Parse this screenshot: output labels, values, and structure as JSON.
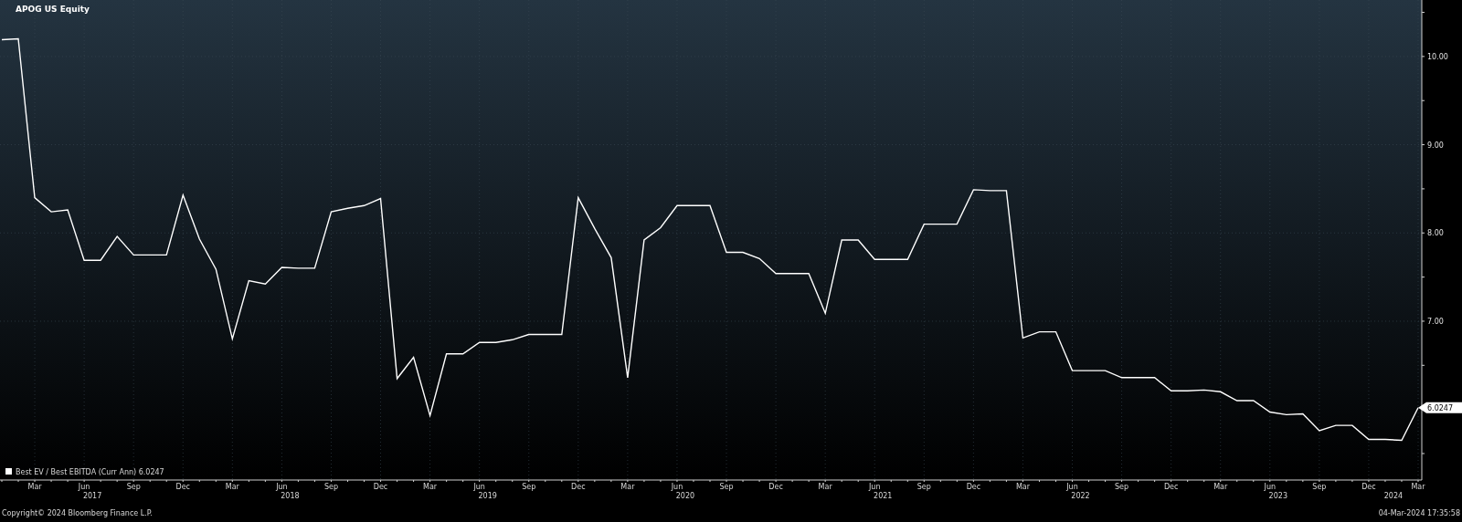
{
  "title": "APOG US Equity",
  "chart": {
    "chart_data": {
      "type": "line",
      "x": [
        "2017-01",
        "2017-02",
        "2017-03",
        "2017-04",
        "2017-05",
        "2017-06",
        "2017-07",
        "2017-08",
        "2017-09",
        "2017-10",
        "2017-11",
        "2017-12",
        "2018-01",
        "2018-02",
        "2018-03",
        "2018-04",
        "2018-05",
        "2018-06",
        "2018-07",
        "2018-08",
        "2018-09",
        "2018-10",
        "2018-11",
        "2018-12",
        "2019-01",
        "2019-02",
        "2019-03",
        "2019-04",
        "2019-05",
        "2019-06",
        "2019-07",
        "2019-08",
        "2019-09",
        "2019-10",
        "2019-11",
        "2019-12",
        "2020-01",
        "2020-02",
        "2020-03",
        "2020-04",
        "2020-05",
        "2020-06",
        "2020-07",
        "2020-08",
        "2020-09",
        "2020-10",
        "2020-11",
        "2020-12",
        "2021-01",
        "2021-02",
        "2021-03",
        "2021-04",
        "2021-05",
        "2021-06",
        "2021-07",
        "2021-08",
        "2021-09",
        "2021-10",
        "2021-11",
        "2021-12",
        "2022-01",
        "2022-02",
        "2022-03",
        "2022-04",
        "2022-05",
        "2022-06",
        "2022-07",
        "2022-08",
        "2022-09",
        "2022-10",
        "2022-11",
        "2022-12",
        "2023-01",
        "2023-02",
        "2023-03",
        "2023-04",
        "2023-05",
        "2023-06",
        "2023-07",
        "2023-08",
        "2023-09",
        "2023-10",
        "2023-11",
        "2023-12",
        "2024-01",
        "2024-02",
        "2024-03"
      ],
      "series": [
        {
          "name": "Best EV / Best EBITDA (Curr Ann)",
          "color": "#ffffff",
          "values": [
            10.19,
            10.2,
            8.4,
            8.24,
            8.26,
            7.69,
            7.69,
            7.96,
            7.75,
            7.75,
            7.75,
            8.43,
            7.93,
            7.59,
            6.8,
            7.46,
            7.42,
            7.61,
            7.6,
            7.6,
            8.24,
            8.28,
            8.31,
            8.39,
            6.35,
            6.59,
            5.93,
            6.63,
            6.63,
            6.76,
            6.76,
            6.79,
            6.85,
            6.85,
            6.85,
            8.4,
            8.05,
            7.72,
            6.36,
            7.92,
            8.06,
            8.31,
            8.31,
            8.31,
            7.78,
            7.78,
            7.71,
            7.54,
            7.54,
            7.54,
            7.09,
            7.92,
            7.92,
            7.7,
            7.7,
            7.7,
            8.1,
            8.1,
            8.1,
            8.49,
            8.48,
            8.48,
            6.81,
            6.88,
            6.88,
            6.44,
            6.44,
            6.44,
            6.36,
            6.36,
            6.36,
            6.21,
            6.21,
            6.22,
            6.2,
            6.1,
            6.1,
            5.97,
            5.94,
            5.95,
            5.76,
            5.82,
            5.82,
            5.66,
            5.66,
            5.65,
            6.02
          ]
        }
      ],
      "xlim": [
        "2017-01",
        "2024-03"
      ],
      "grid": true,
      "ylim": [
        5.2,
        10.64
      ],
      "yticks": [
        {
          "value": 7,
          "label": "7.00"
        },
        {
          "value": 8,
          "label": "8.00"
        },
        {
          "value": 9,
          "label": "9.00"
        },
        {
          "value": 10,
          "label": "10.00"
        }
      ],
      "xticks": [
        {
          "value": "2017-03",
          "label": "Mar"
        },
        {
          "value": "2017-06",
          "label": "Jun"
        },
        {
          "value": "2017-09",
          "label": "Sep"
        },
        {
          "value": "2017-12",
          "label": "Dec"
        },
        {
          "value": "2018-03",
          "label": "Mar"
        },
        {
          "value": "2018-06",
          "label": "Jun"
        },
        {
          "value": "2018-09",
          "label": "Sep"
        },
        {
          "value": "2018-12",
          "label": "Dec"
        },
        {
          "value": "2019-03",
          "label": "Mar"
        },
        {
          "value": "2019-06",
          "label": "Jun"
        },
        {
          "value": "2019-09",
          "label": "Sep"
        },
        {
          "value": "2019-12",
          "label": "Dec"
        },
        {
          "value": "2020-03",
          "label": "Mar"
        },
        {
          "value": "2020-06",
          "label": "Jun"
        },
        {
          "value": "2020-09",
          "label": "Sep"
        },
        {
          "value": "2020-12",
          "label": "Dec"
        },
        {
          "value": "2021-03",
          "label": "Mar"
        },
        {
          "value": "2021-06",
          "label": "Jun"
        },
        {
          "value": "2021-09",
          "label": "Sep"
        },
        {
          "value": "2021-12",
          "label": "Dec"
        },
        {
          "value": "2022-03",
          "label": "Mar"
        },
        {
          "value": "2022-06",
          "label": "Jun"
        },
        {
          "value": "2022-09",
          "label": "Sep"
        },
        {
          "value": "2022-12",
          "label": "Dec"
        },
        {
          "value": "2023-03",
          "label": "Mar"
        },
        {
          "value": "2023-06",
          "label": "Jun"
        },
        {
          "value": "2023-09",
          "label": "Sep"
        },
        {
          "value": "2023-12",
          "label": "Dec"
        },
        {
          "value": "2024-03",
          "label": "Mar"
        }
      ],
      "annotations": [
        {
          "text": "6.0247",
          "x": "2024-03",
          "y": 6.02
        }
      ]
    },
    "year_labels": [
      "2017",
      "2018",
      "2019",
      "2020",
      "2021",
      "2022",
      "2023",
      "2024"
    ],
    "legend": {
      "value": "6.0247"
    }
  },
  "footer": {
    "copyright": "Copyright© 2024 Bloomberg Finance L.P.",
    "timestamp": "04-Mar-2024 17:35:58"
  }
}
